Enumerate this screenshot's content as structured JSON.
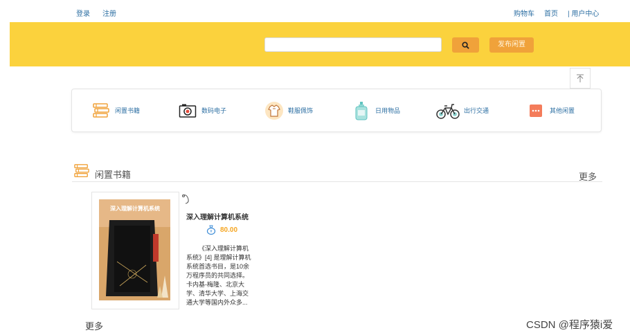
{
  "top_nav": {
    "login": "登录",
    "register": "注册",
    "cart": "购物车",
    "home": "首页",
    "user_center": "| 用户中心"
  },
  "search": {
    "placeholder": "",
    "value": "",
    "search_icon": "search-icon",
    "publish_label": "发布闲置"
  },
  "colors": {
    "banner": "#fbd23d",
    "button": "#f0a23a",
    "link": "#2d6fa3",
    "price": "#f5a623"
  },
  "categories": [
    {
      "label": "闲置书籍",
      "icon": "books-icon"
    },
    {
      "label": "数码电子",
      "icon": "camera-icon"
    },
    {
      "label": "鞋服佩饰",
      "icon": "shirt-icon"
    },
    {
      "label": "日用物品",
      "icon": "bottle-icon"
    },
    {
      "label": "出行交通",
      "icon": "bicycle-icon"
    },
    {
      "label": "其他闲置",
      "icon": "more-icon"
    }
  ],
  "section": {
    "title": "闲置书籍",
    "more": "更多"
  },
  "products": [
    {
      "title": "深入理解计算机系统",
      "price": "80.00",
      "description": "《深入理解计算机系统》[4] 是理解计算机系统首选书目，是10余万程序员的共同选择。卡内基-梅隆、北京大学、清华大学、上海交通大学等国内外众多...",
      "cover_text": "深入理解计算机系统"
    }
  ],
  "bottom_more": "更多",
  "watermark": "CSDN @程序猿i爱"
}
